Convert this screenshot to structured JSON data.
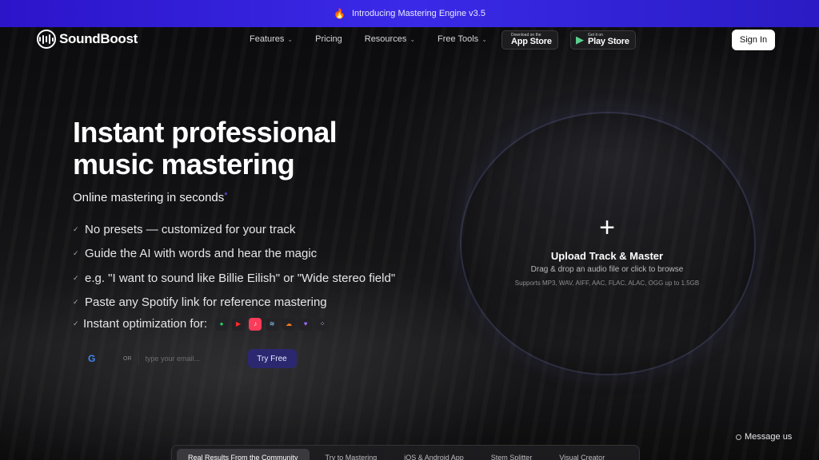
{
  "announcement": {
    "icon": "fire-icon",
    "text": "Introducing Mastering Engine v3.5"
  },
  "header": {
    "logo_text": "SoundBoost",
    "nav": [
      {
        "label": "Features",
        "has_dropdown": true
      },
      {
        "label": "Pricing",
        "has_dropdown": false
      },
      {
        "label": "Resources",
        "has_dropdown": true
      },
      {
        "label": "Free Tools",
        "has_dropdown": true
      }
    ],
    "app_store": {
      "small": "Download on the",
      "big": "App Store"
    },
    "play_store": {
      "small": "Get it on",
      "big": "Play Store"
    },
    "signin_label": "Sign In"
  },
  "hero": {
    "title_line1": "Instant professional",
    "title_line2": "music mastering",
    "subtitle": "Online mastering in seconds",
    "subtitle_mark": "*",
    "features": [
      "No presets — customized for your track",
      "Guide the AI with words and hear the magic",
      "e.g. \"I want to sound like Billie Eilish\" or \"Wide stereo field\"",
      "Paste any Spotify link for reference mastering"
    ],
    "optimization_label": "Instant optimization for:",
    "platforms": [
      "spotify-icon",
      "youtube-icon",
      "apple-music-icon",
      "deezer-icon",
      "soundcloud-icon",
      "tidal-heart-icon",
      "dots-icon"
    ]
  },
  "signup": {
    "or_label": "OR",
    "email_placeholder": "type your email...",
    "try_free_label": "Try Free"
  },
  "upload": {
    "title": "Upload Track & Master",
    "description": "Drag & drop an audio file or click to browse",
    "supported": "Supports MP3, WAV, AIFF, AAC, FLAC, ALAC, OGG up to 1.5GB"
  },
  "tabs": [
    "Real Results From the Community",
    "Try to Mastering",
    "iOS & Android App",
    "Stem Splitter",
    "Visual Creator"
  ],
  "message_label": "Message us",
  "colors": {
    "accent": "#3a2ae8",
    "try_free_bg": "#2b2870"
  }
}
